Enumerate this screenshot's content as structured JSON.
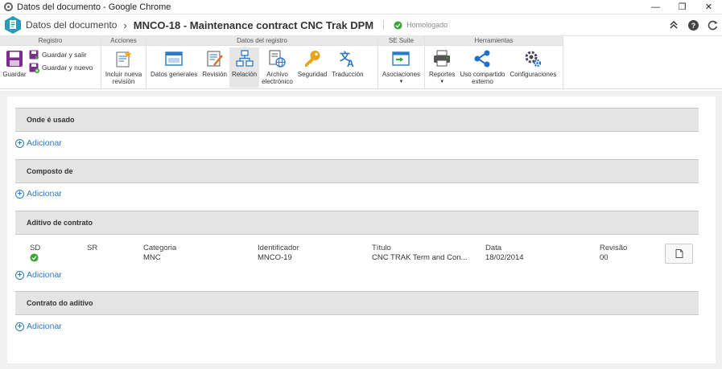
{
  "window": {
    "title": "Datos del documento - Google Chrome"
  },
  "header": {
    "breadcrumb": "Datos del documento",
    "doc_title": "MNCO-18 - Maintenance contract CNC Trak DPM",
    "status": "Homologado"
  },
  "ribbon": {
    "groups": {
      "registro": "Registro",
      "acciones": "Acciones",
      "datos": "Datos del registro",
      "suite": "SE Suite",
      "herramientas": "Herramientas"
    },
    "buttons": {
      "guardar": "Guardar",
      "guardar_salir": "Guardar y salir",
      "guardar_nuevo": "Guardar y nuevo",
      "incluir_1": "Incluir nueva",
      "incluir_2": "revisión",
      "datos_generales": "Datos generales",
      "revision": "Revisión",
      "relacion": "Relación",
      "archivo_1": "Archivo",
      "archivo_2": "electrónico",
      "seguridad": "Seguridad",
      "traduccion": "Traducción",
      "asociaciones": "Asociaciones",
      "reportes": "Reportes",
      "uso_1": "Uso compartido",
      "uso_2": "externo",
      "configuraciones": "Configuraciones"
    },
    "colors": {
      "save": "#7b2d8e",
      "accent_blue": "#2c7bc2",
      "key": "#e8a317",
      "share": "#1e6fd0"
    }
  },
  "sections": [
    {
      "title": "Onde é usado",
      "add": "Adicionar"
    },
    {
      "title": "Composto de",
      "add": "Adicionar"
    },
    {
      "title": "Aditivo de contrato",
      "add": "Adicionar"
    },
    {
      "title": "Contrato do aditivo",
      "add": "Adicionar"
    }
  ],
  "table": {
    "headers": {
      "sd": "SD",
      "sr": "SR",
      "categoria": "Categoria",
      "identificador": "Identificador",
      "titulo": "Título",
      "data": "Data",
      "revisao": "Revisão"
    },
    "row": {
      "categoria": "MNC",
      "identificador": "MNCO-19",
      "titulo": "CNC TRAK Term and Con...",
      "data": "18/02/2014",
      "revisao": "00"
    }
  }
}
